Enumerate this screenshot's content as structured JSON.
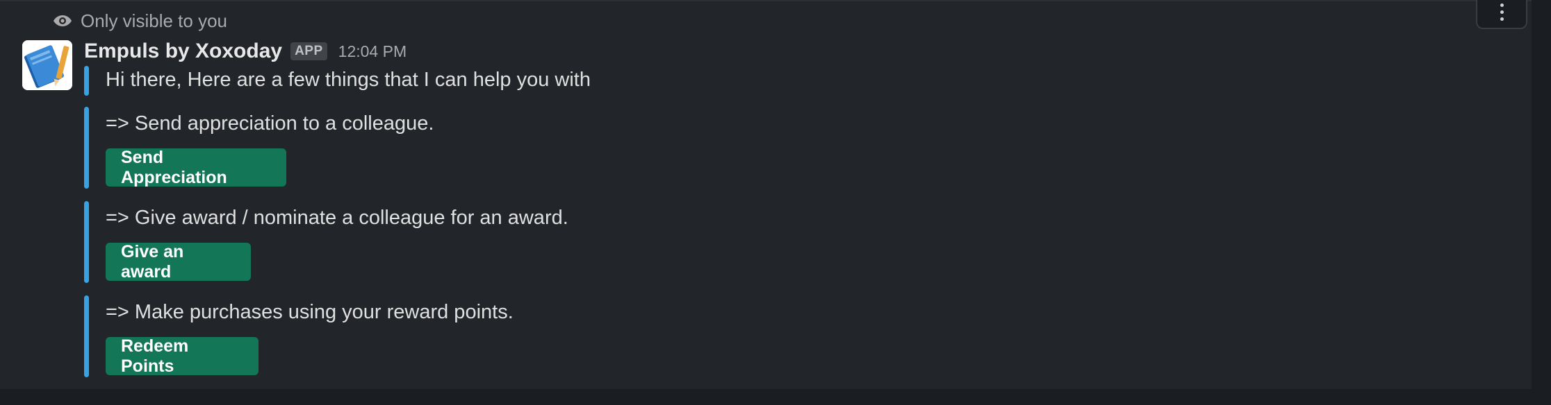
{
  "visibility": {
    "text": "Only visible to you",
    "icon": "eye-icon"
  },
  "message": {
    "sender": "Empuls by Xoxoday",
    "badge": "APP",
    "time": "12:04 PM",
    "avatar_icon": "blue-book-pencil-icon",
    "intro": "Hi there, Here are a few things that I can help you with",
    "sections": [
      {
        "text": "=> Send appreciation to a colleague.",
        "button": "Send Appreciation"
      },
      {
        "text": "=> Give award / nominate a colleague for an award.",
        "button": "Give an award"
      },
      {
        "text": "=> Make purchases using your reward points.",
        "button": "Redeem Points"
      }
    ]
  },
  "toolbar": {
    "more_icon": "more-vertical-icon"
  },
  "colors": {
    "background": "#222529",
    "attachment_bar": "#36a3e4",
    "button": "#137656",
    "button_text": "#ffffff"
  }
}
